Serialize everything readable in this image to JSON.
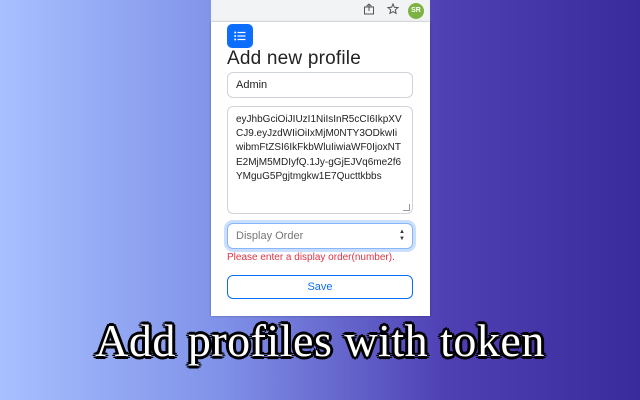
{
  "browser": {
    "share_icon": "share-icon",
    "star_icon": "star-icon",
    "avatar_initials": "SR"
  },
  "popup": {
    "menu_icon": "list-icon",
    "title": "Add new profile",
    "name_value": "Admin",
    "token_value": "eyJhbGciOiJIUzI1NiIsInR5cCI6IkpXVCJ9.eyJzdWIiOiIxMjM0NTY3ODkwIiwibmFtZSI6IkFkbWluIiwiaWF0IjoxNTE2MjM5MDIyfQ.1Jy-gGjEJVq6me2f6YMguG5Pgjtmgkw1E7Qucttkbbs",
    "order_placeholder": "Display Order",
    "order_error": "Please enter a display order(number).",
    "save_label": "Save"
  },
  "caption": "Add profiles with token",
  "colors": {
    "primary": "#0d6efd",
    "danger": "#dc3545",
    "bg_left": "#a8c0ff",
    "bg_right": "#3a2b9c"
  }
}
